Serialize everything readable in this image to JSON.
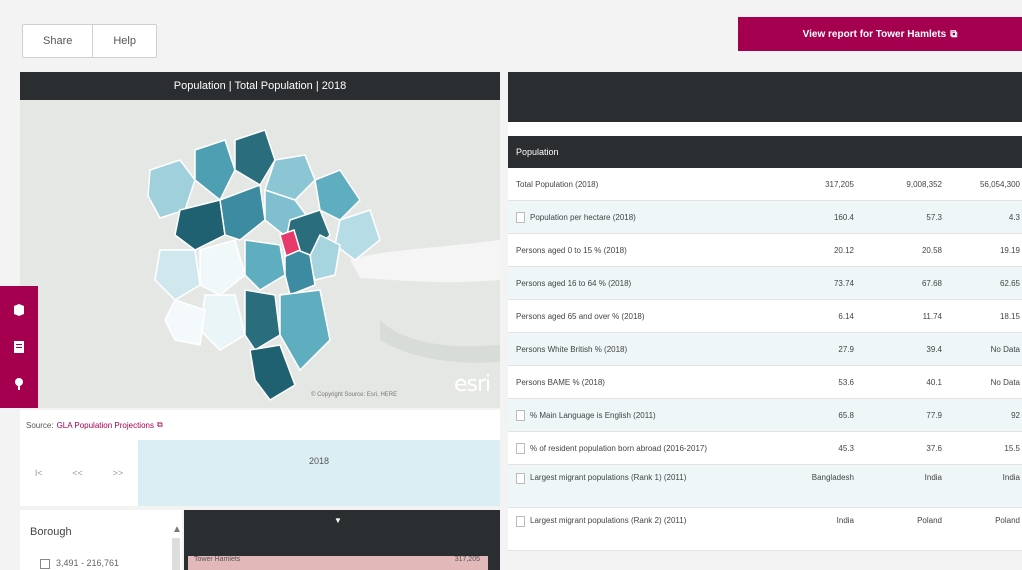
{
  "toolbar": {
    "share_label": "Share",
    "help_label": "Help"
  },
  "report_button": {
    "label": "View report for Tower Hamlets",
    "ext_glyph": "⧉"
  },
  "map": {
    "title": "Population | Total Population | 2018",
    "esri": "esri",
    "attribution": "© Copyright Source: Esri, HERE",
    "tools": [
      "layers-icon",
      "document-icon",
      "pin-icon"
    ]
  },
  "source": {
    "prefix": "Source:",
    "link": "GLA Population Projections",
    "ext_glyph": "⧉"
  },
  "timeline": {
    "controls": [
      "I<",
      "<<",
      ">>"
    ],
    "year": "2018"
  },
  "borough": {
    "label": "Borough",
    "option": "3,491 - 216,761"
  },
  "list": {
    "row_label": "Tower Hamlets",
    "row_value": "317,205"
  },
  "table": {
    "section": "Population",
    "rows": [
      {
        "label": "Total Population (2018)",
        "v1": "317,205",
        "v2": "9,008,352",
        "v3": "56,054,300",
        "indent": false
      },
      {
        "label": "Population per hectare (2018)",
        "v1": "160.4",
        "v2": "57.3",
        "v3": "4.3",
        "indent": true
      },
      {
        "label": "Persons aged 0 to 15 % (2018)",
        "v1": "20.12",
        "v2": "20.58",
        "v3": "19.19",
        "indent": false
      },
      {
        "label": "Persons aged 16 to 64 % (2018)",
        "v1": "73.74",
        "v2": "67.68",
        "v3": "62.65",
        "indent": false
      },
      {
        "label": "Persons aged 65 and over % (2018)",
        "v1": "6.14",
        "v2": "11.74",
        "v3": "18.15",
        "indent": false
      },
      {
        "label": "Persons White British % (2018)",
        "v1": "27.9",
        "v2": "39.4",
        "v3": "No Data",
        "indent": false
      },
      {
        "label": "Persons BAME % (2018)",
        "v1": "53.6",
        "v2": "40.1",
        "v3": "No Data",
        "indent": false
      },
      {
        "label": "% Main Language is English (2011)",
        "v1": "65.8",
        "v2": "77.9",
        "v3": "92",
        "indent": true
      },
      {
        "label": "% of resident population born abroad (2016-2017)",
        "v1": "45.3",
        "v2": "37.6",
        "v3": "15.5",
        "indent": true
      },
      {
        "label": "Largest migrant populations (Rank 1) (2011)",
        "v1": "Bangladesh",
        "v2": "India",
        "v3": "India",
        "indent": true
      },
      {
        "label": "Largest migrant populations (Rank 2) (2011)",
        "v1": "India",
        "v2": "Poland",
        "v3": "Poland",
        "indent": true
      }
    ]
  },
  "colors": {
    "brand": "#a4004f",
    "dark": "#2b2e30",
    "teal_dark": "#1f6170",
    "teal_light": "#cfe8ee"
  }
}
